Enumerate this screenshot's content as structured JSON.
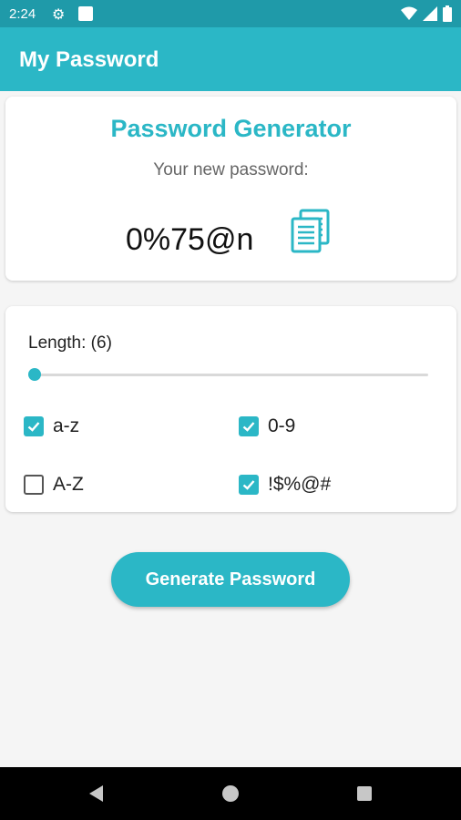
{
  "status_bar": {
    "time": "2:24",
    "icons": [
      "gear-icon",
      "notification-square-icon",
      "wifi-icon",
      "signal-icon",
      "battery-icon"
    ]
  },
  "app_bar": {
    "title": "My Password"
  },
  "generator": {
    "title": "Password Generator",
    "subtitle": "Your new password:",
    "password": "0%75@n",
    "copy_icon": "copy-icon"
  },
  "options": {
    "length_label": "Length: (6)",
    "length_value": 6,
    "slider_fraction": 0.0,
    "checkboxes": [
      {
        "label": "a-z",
        "checked": true
      },
      {
        "label": "0-9",
        "checked": true
      },
      {
        "label": "A-Z",
        "checked": false
      },
      {
        "label": "!$%@#",
        "checked": true
      }
    ]
  },
  "actions": {
    "generate_label": "Generate Password"
  },
  "colors": {
    "primary": "#2bb7c6",
    "primary_dark": "#1f9aa9",
    "background": "#f5f5f5"
  },
  "nav_bar": {
    "icons": [
      "back-icon",
      "home-icon",
      "recents-icon"
    ]
  }
}
